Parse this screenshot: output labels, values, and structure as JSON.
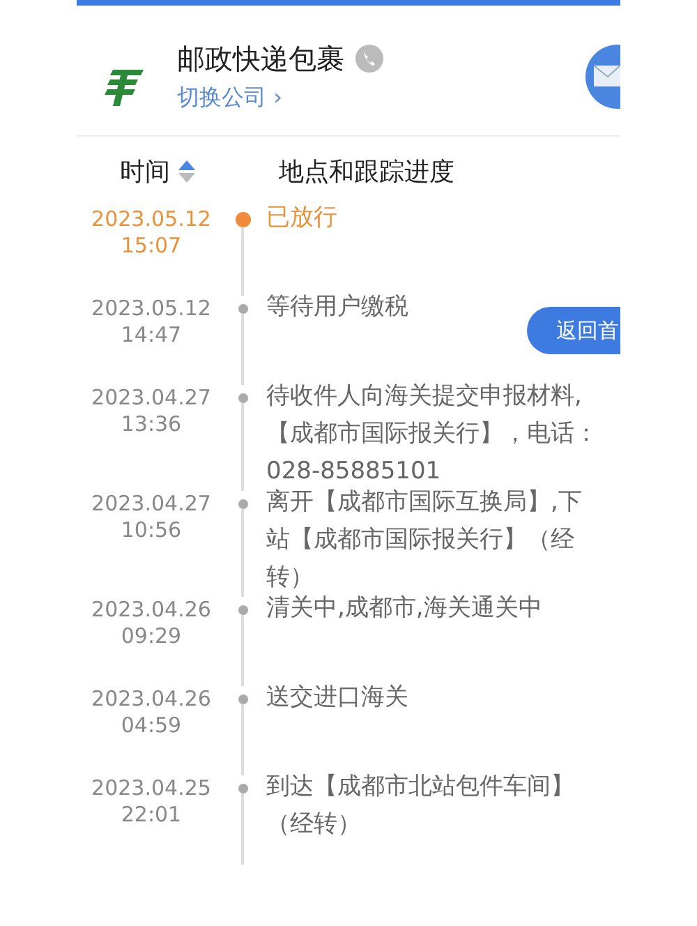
{
  "carrier": {
    "name": "邮政快递包裹",
    "switch_link": "切换公司 ›"
  },
  "columns": {
    "time": "时间",
    "progress": "地点和跟踪进度"
  },
  "events": [
    {
      "date": "2023.05.12",
      "time": "15:07",
      "lines": [
        "已放行"
      ],
      "latest": true
    },
    {
      "date": "2023.05.12",
      "time": "14:47",
      "lines": [
        "等待用户缴税"
      ],
      "latest": false
    },
    {
      "date": "2023.04.27",
      "time": "13:36",
      "lines": [
        "待收件人向海关提交申报材料,",
        "【成都市国际报关行】，电话：",
        "028-85885101"
      ],
      "latest": false
    },
    {
      "date": "2023.04.27",
      "time": "10:56",
      "lines": [
        "离开【成都市国际互换局】,下",
        "站【成都市国际报关行】（经",
        "转）"
      ],
      "latest": false
    },
    {
      "date": "2023.04.26",
      "time": "09:29",
      "lines": [
        "清关中,成都市,海关通关中"
      ],
      "latest": false
    },
    {
      "date": "2023.04.26",
      "time": "04:59",
      "lines": [
        "送交进口海关"
      ],
      "latest": false
    },
    {
      "date": "2023.04.25",
      "time": "22:01",
      "lines": [
        "到达【成都市北站包件车间】",
        "（经转）"
      ],
      "latest": false
    }
  ],
  "float_button": "返回首"
}
